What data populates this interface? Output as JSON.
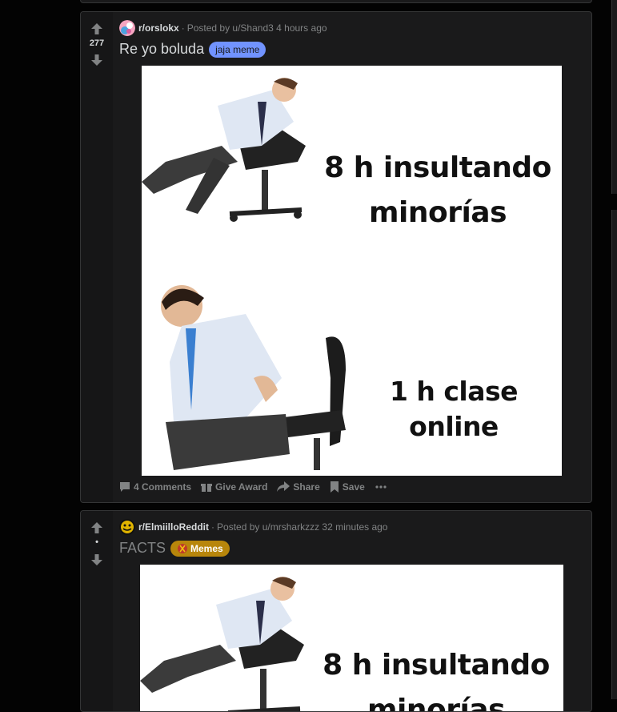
{
  "posts": [
    {
      "subreddit": "r/orslokx",
      "posted_prefix": "Posted by",
      "author": "u/Shand3",
      "time": "4 hours ago",
      "votes": "277",
      "title": "Re yo boluda",
      "flair": "jaja meme",
      "flair_bg": "#7193ff",
      "flair_color": "#1a1a1b",
      "meme_top": [
        "8 h insultando",
        "minorías"
      ],
      "meme_bottom": "1 h clase online",
      "comments": "4 Comments",
      "give_award": "Give Award",
      "share": "Share",
      "save": "Save"
    },
    {
      "subreddit": "r/ElmiilloReddit",
      "posted_prefix": "Posted by",
      "author": "u/mrsharkzzz",
      "time": "32 minutes ago",
      "votes": "•",
      "title": "FACTS",
      "flair": "Memes",
      "flair_bg": "#b8860b",
      "flair_color": "#ffffff",
      "meme_top": [
        "8 h insultando",
        "minorías"
      ]
    }
  ],
  "colors": {
    "background": "#030303",
    "card": "#1a1a1b",
    "meta_text": "#818384"
  }
}
